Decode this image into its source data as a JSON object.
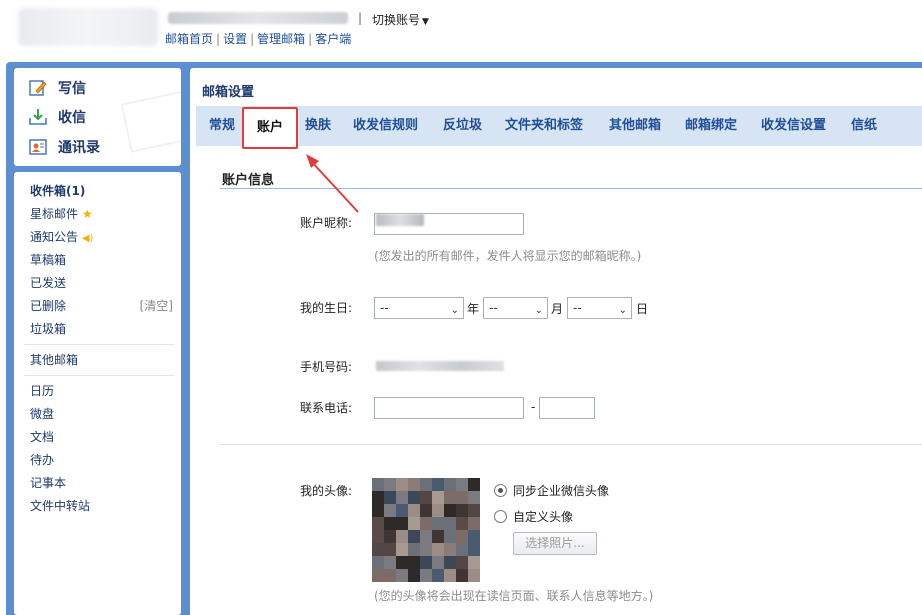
{
  "header": {
    "switch_account": "切换账号",
    "links": [
      "邮箱首页",
      "设置",
      "管理邮箱",
      "客户端"
    ]
  },
  "quick": [
    {
      "label": "写信",
      "icon": "compose-icon"
    },
    {
      "label": "收信",
      "icon": "inbox-download-icon"
    },
    {
      "label": "通讯录",
      "icon": "contacts-icon"
    }
  ],
  "folders": {
    "inbox": "收件箱(1)",
    "starred": "星标邮件",
    "notices": "通知公告",
    "drafts": "草稿箱",
    "sent": "已发送",
    "deleted": "已删除",
    "clear": "[清空]",
    "spam": "垃圾箱",
    "other": "其他邮箱",
    "calendar": "日历",
    "drive": "微盘",
    "docs": "文档",
    "todo": "待办",
    "notes": "记事本",
    "transfer": "文件中转站"
  },
  "main": {
    "title": "邮箱设置",
    "tabs": [
      "常规",
      "账户",
      "换肤",
      "收发信规则",
      "反垃圾",
      "文件夹和标签",
      "其他邮箱",
      "邮箱绑定",
      "收发信设置",
      "信纸"
    ],
    "active_tab": "账户",
    "section": "账户信息",
    "nickname_label": "账户昵称:",
    "nickname_hint": "(您发出的所有邮件，发件人将显示您的邮箱昵称。)",
    "birthday_label": "我的生日:",
    "birthday_year": "--",
    "birthday_month": "--",
    "birthday_day": "--",
    "unit_year": "年",
    "unit_month": "月",
    "unit_day": "日",
    "mobile_label": "手机号码:",
    "phone_label": "联系电话:",
    "phone_dash": "-",
    "avatar_label": "我的头像:",
    "avatar_opt1": "同步企业微信头像",
    "avatar_opt2": "自定义头像",
    "choose_photo": "选择照片...",
    "avatar_hint": "(您的头像将会出现在读信页面、联系人信息等地方。)"
  },
  "colors": {
    "frame_blue": "#5b8fd0",
    "tab_bar": "#d7e4f3",
    "link_blue": "#1f4f9a",
    "highlight_red": "#e23b3b"
  }
}
